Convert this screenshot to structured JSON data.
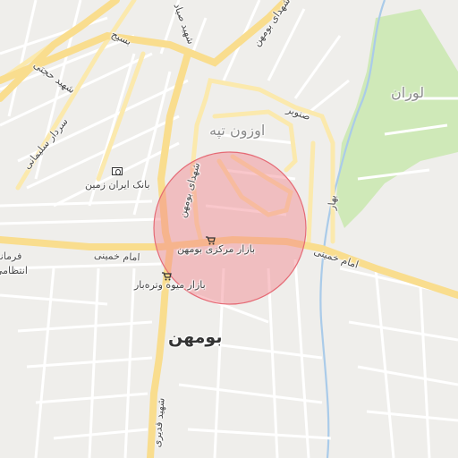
{
  "map": {
    "places": {
      "bumehen": "بومهن",
      "owzun_tappeh": "اوزون تپه",
      "lavaran": "لوران"
    },
    "roads": {
      "imam_khomeini_west": "امام خمینی",
      "imam_khomeini_east": "امام خمینی",
      "basij": "بسیج",
      "shahid_hojjati": "شهید حجتی",
      "sardar_soleimani": "سردار سلیمانی",
      "shohada_bumehen_vertical": "شهدای بومهن",
      "shohada_bumehen_top": "شهدای بومهن",
      "sonobar": "صنوبر",
      "bahar": "بهار",
      "shahid_sayad_top": "شهید صیاد",
      "shahid_ghadiri": "شهید قدیری",
      "edge_left_1": "فرمانداری",
      "edge_left_2": "انتظامی"
    },
    "pois": {
      "bank": "بانک ایران زمین",
      "bazaar_markazi": "بازار مرکزی بومهن",
      "bazaar_fruit": "بازار میوه وتره‌بار"
    },
    "icons": {
      "bank": "bank-icon",
      "shop": "cart-icon"
    },
    "colors": {
      "background": "#efeeeb",
      "park": "#cfe9b8",
      "major_road": "#f9dd8e",
      "secondary_road": "#fbe9ad",
      "minor_road": "#ffffff",
      "river": "#aacbe9",
      "highlight_circle": "#f2828b"
    }
  }
}
